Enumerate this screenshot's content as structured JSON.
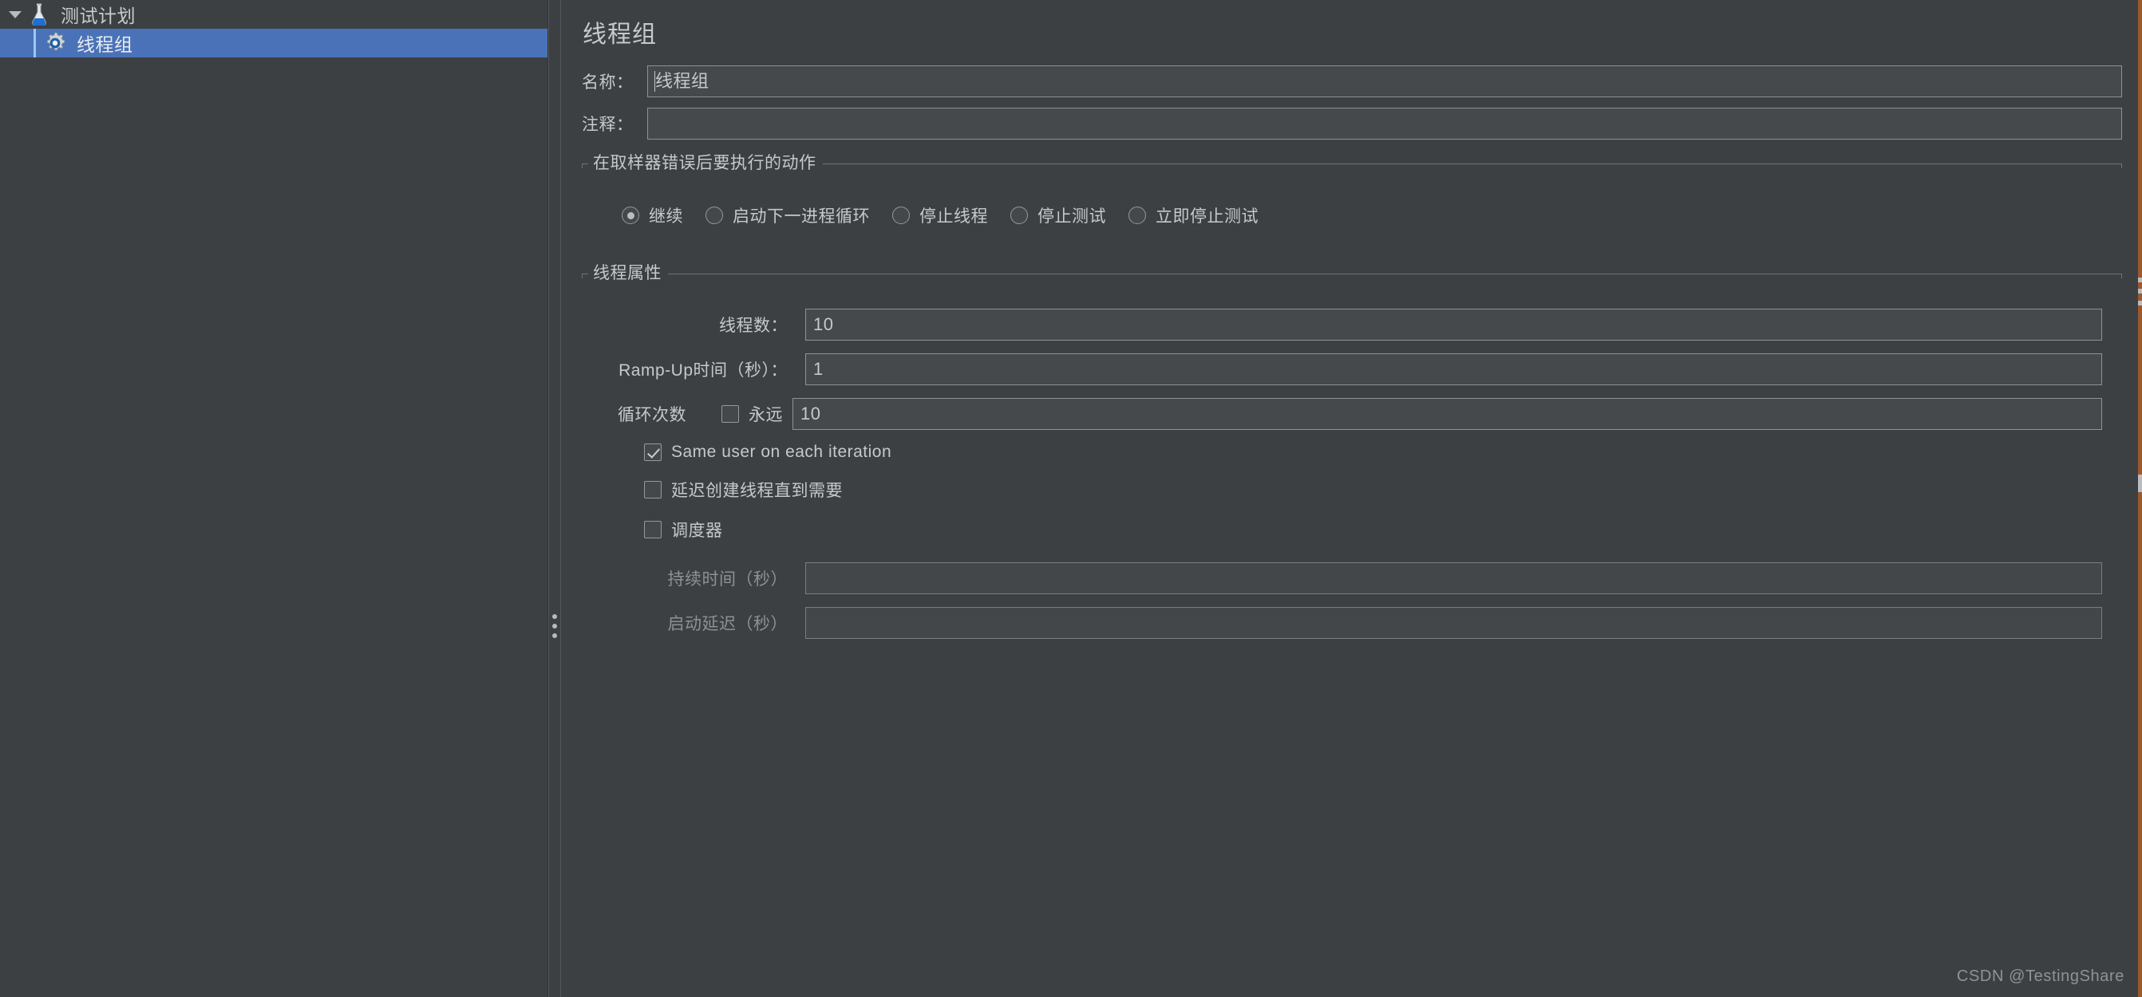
{
  "tree": {
    "root": {
      "label": "测试计划",
      "icon": "flask-icon",
      "expanded": true
    },
    "child": {
      "label": "线程组",
      "icon": "gear-icon",
      "selected": true
    }
  },
  "panel": {
    "title": "线程组",
    "name_label": "名称：",
    "name_value": "线程组",
    "comment_label": "注释：",
    "comment_value": ""
  },
  "error_action": {
    "group_title": "在取样器错误后要执行的动作",
    "options": [
      {
        "label": "继续",
        "checked": true
      },
      {
        "label": "启动下一进程循环",
        "checked": false
      },
      {
        "label": "停止线程",
        "checked": false
      },
      {
        "label": "停止测试",
        "checked": false
      },
      {
        "label": "立即停止测试",
        "checked": false
      }
    ]
  },
  "thread_props": {
    "group_title": "线程属性",
    "num_threads_label": "线程数：",
    "num_threads_value": "10",
    "ramp_up_label": "Ramp-Up时间（秒）：",
    "ramp_up_value": "1",
    "loop_label": "循环次数",
    "forever_label": "永远",
    "forever_checked": false,
    "loop_value": "10",
    "same_user_label": "Same user on each iteration",
    "same_user_checked": true,
    "delay_create_label": "延迟创建线程直到需要",
    "delay_create_checked": false,
    "scheduler_label": "调度器",
    "scheduler_checked": false,
    "duration_label": "持续时间（秒）",
    "duration_value": "",
    "startup_delay_label": "启动延迟（秒）",
    "startup_delay_value": ""
  },
  "watermark": {
    "text": "CSDN @TestingShare"
  },
  "colors": {
    "background": "#3c4043",
    "selection": "#4a72b8",
    "field_bg": "#45494c",
    "field_border": "#8e9295",
    "text": "#c5c9cb",
    "text_dim": "#8d9194",
    "edge_strip": "#9a5a2f"
  }
}
